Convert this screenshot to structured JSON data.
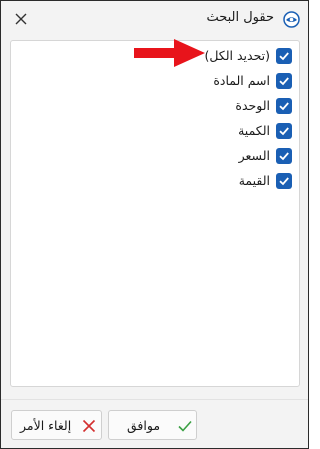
{
  "dialog": {
    "title": "حقول البحث",
    "title_icon": "eye-icon",
    "close_icon": "close-icon"
  },
  "items": [
    {
      "label": "(تحديد الكل)",
      "checked": true
    },
    {
      "label": "اسم المادة",
      "checked": true
    },
    {
      "label": "الوحدة",
      "checked": true
    },
    {
      "label": "الكمية",
      "checked": true
    },
    {
      "label": "السعر",
      "checked": true
    },
    {
      "label": "القيمة",
      "checked": true
    }
  ],
  "annotation": {
    "arrow_icon": "red-arrow-icon",
    "color": "#e8141b"
  },
  "buttons": {
    "ok_label": "موافق",
    "ok_icon": "checkmark-icon",
    "cancel_label": "إلغاء الأمر",
    "cancel_icon": "x-icon"
  },
  "colors": {
    "checkbox": "#1a5fb4",
    "ok_check": "#3aa043",
    "cancel_x": "#d32f2f"
  }
}
